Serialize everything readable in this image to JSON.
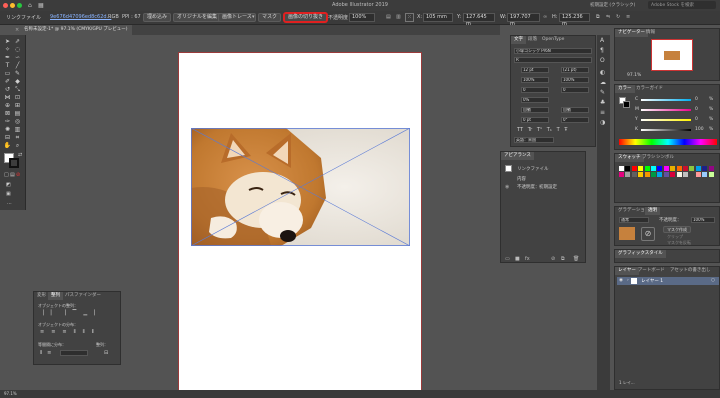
{
  "window": {
    "app_title": "Adobe Illustrator 2019",
    "workspace_label": "初期設定 (クラシック)",
    "search_placeholder": "Adobe Stock を検索"
  },
  "control_bar": {
    "link_file_label": "リンクファイル",
    "file_name": "9e676d47096ed8c62d...",
    "color_mode": "RGB",
    "ppi": "PPI : 67",
    "embed_button": "埋め込み",
    "edit_original_button": "オリジナルを編集",
    "image_trace_button": "画像トレース",
    "mask_button": "マスク",
    "crop_image_button": "画像の切り抜き",
    "opacity_label": "不透明度",
    "opacity_value": "100%",
    "x_label": "X:",
    "x_value": "105 mm",
    "y_label": "Y:",
    "y_value": "127.645 m",
    "w_label": "W:",
    "w_value": "197.707 m",
    "h_label": "H:",
    "h_value": "125.236 m"
  },
  "document_tab": {
    "label": "名称未設定-1* @ 97.1% (CMYK/GPU プレビュー)"
  },
  "character_panel": {
    "tabs": [
      "文字",
      "段落",
      "OpenType"
    ],
    "font_family": "小塚ゴシック Pr6N",
    "font_style": "R",
    "font_size": "12 pt",
    "leading": "(21 pt)",
    "vertical_scale": "100%",
    "horizontal_scale": "100%",
    "tracking": "0",
    "kerning": "0",
    "tsume": "0%",
    "aki_left": "自動",
    "aki_right": "自動",
    "baseline": "0 pt",
    "rotation": "0°",
    "language": "英語：米国"
  },
  "appearance_panel": {
    "title": "アピアランス",
    "item_label": "リンクファイル",
    "content_label": "内容",
    "opacity_label": "不透明度：",
    "opacity_value": "初期設定"
  },
  "navigator_panel": {
    "tabs": [
      "ナビゲーター",
      "情報"
    ],
    "zoom": "97.1%"
  },
  "color_panel": {
    "tabs": [
      "カラー",
      "カラーガイド"
    ],
    "channels": [
      {
        "label": "C",
        "value": "0"
      },
      {
        "label": "M",
        "value": "0"
      },
      {
        "label": "Y",
        "value": "0"
      },
      {
        "label": "K",
        "value": "100"
      }
    ],
    "percent_sign": "%"
  },
  "swatches_panel": {
    "tabs": [
      "スウォッチ",
      "ブラシ",
      "シンボル"
    ],
    "colors": [
      "#ffffff",
      "#000000",
      "#ff0000",
      "#ffff00",
      "#00ff00",
      "#00ffff",
      "#0000ff",
      "#ff00ff",
      "#e8b000",
      "#ff6a00",
      "#c8102e",
      "#8cc63f",
      "#00a0e9",
      "#1d2088",
      "#920783",
      "#e4007f",
      "#a0a0a0",
      "#606060",
      "#fcc800",
      "#f39800",
      "#009944",
      "#00a7ea",
      "#5f52a0",
      "#d7003a",
      "#f8f4e6",
      "#c0c0c0",
      "#404040",
      "#ff9999",
      "#99ccff",
      "#ccff99"
    ]
  },
  "transparency_panel": {
    "tabs": [
      "グラデーション",
      "透明"
    ],
    "mode": "通常",
    "opacity_label": "不透明度：",
    "opacity_value": "100%",
    "make_mask_button": "マスク作成",
    "clip_label": "クリップ",
    "invert_mask_label": "マスクを反転"
  },
  "graphic_style_panel": {
    "title": "グラフィックスタイル"
  },
  "layers_panel": {
    "tabs": [
      "レイヤー",
      "アートボード",
      "アセットの書き出し"
    ],
    "layer_name": "レイヤー 1",
    "status": "1 レイ..."
  },
  "align_panel": {
    "tabs": [
      "変形",
      "整列",
      "パスファインダー"
    ],
    "align_objects_label": "オブジェクトの整列：",
    "distribute_objects_label": "オブジェクトの分布：",
    "distribute_spacing_label": "等間隔に分布：",
    "align_to_label": "整列："
  },
  "status_bar": {
    "zoom": "97.1%"
  }
}
